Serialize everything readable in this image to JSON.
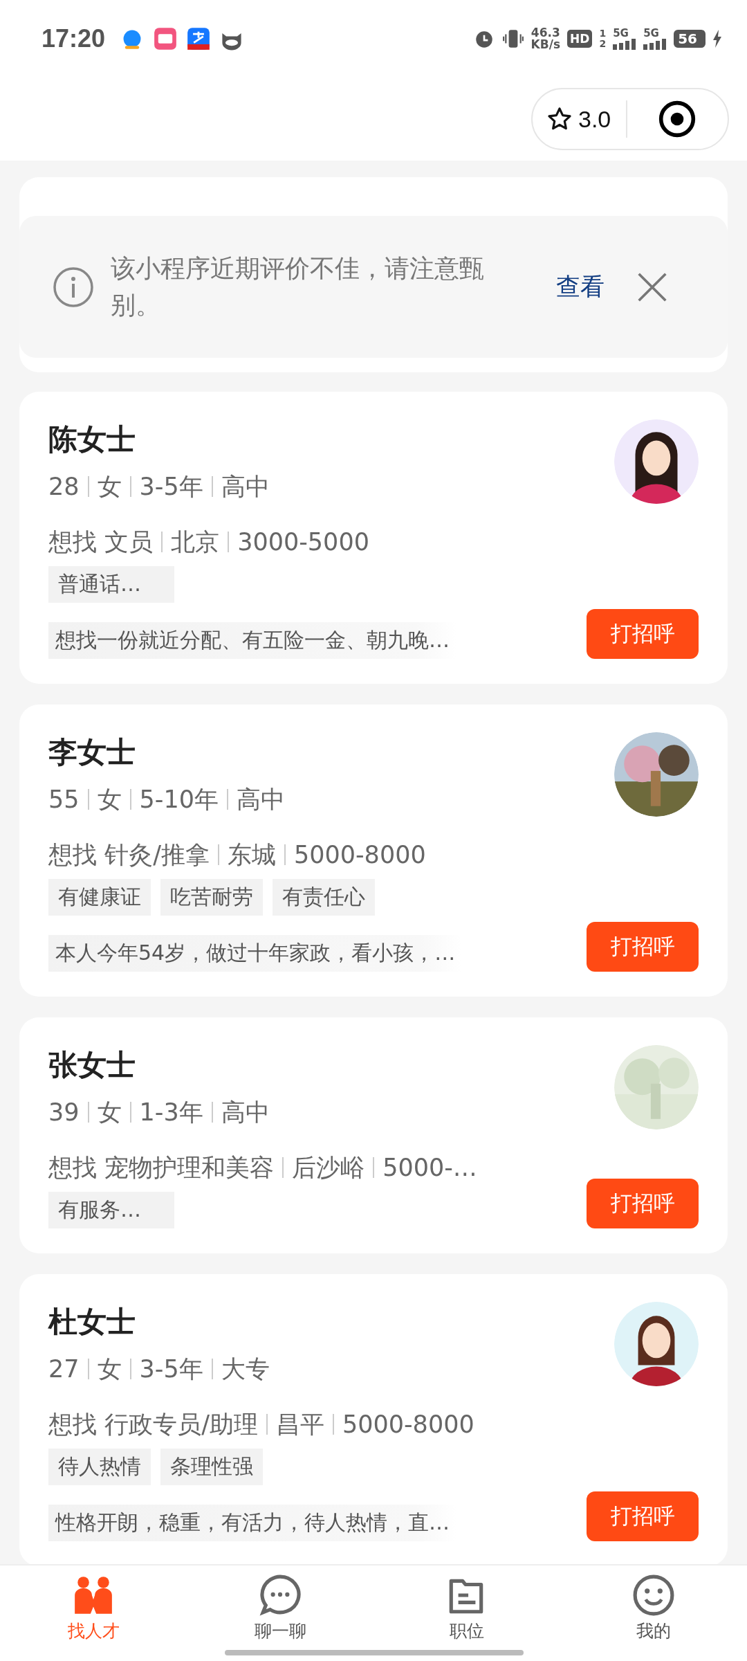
{
  "status_bar": {
    "time": "17:20",
    "net_speed": "46.3",
    "net_unit": "KB/s",
    "hd": "HD",
    "sim_1": "1",
    "sim_2": "2",
    "signal_1": "5G",
    "signal_2": "5G",
    "battery": "56"
  },
  "capsule": {
    "rating": "3.0"
  },
  "notice": {
    "text": "该小程序近期评价不佳，请注意甄别。",
    "action": "查看"
  },
  "candidates": [
    {
      "name": "陈女士",
      "meta": [
        "28",
        "女",
        "3-5年",
        "高中"
      ],
      "want": [
        "想找 文员",
        "北京",
        "3000-5000"
      ],
      "tags": [
        "普通话…"
      ],
      "intro": "想找一份就近分配、有五险一金、朝九晚…",
      "button": "打招呼",
      "avatar": {
        "kind": "illustration"
      }
    },
    {
      "name": "李女士",
      "meta": [
        "55",
        "女",
        "5-10年",
        "高中"
      ],
      "want": [
        "想找 针灸/推拿",
        "东城",
        "5000-8000"
      ],
      "tags": [
        "有健康证",
        "吃苦耐劳",
        "有责任心"
      ],
      "intro": "本人今年54岁，做过十年家政，看小孩，…",
      "button": "打招呼",
      "avatar": {
        "kind": "picture"
      }
    },
    {
      "name": "张女士",
      "meta": [
        "39",
        "女",
        "1-3年",
        "高中"
      ],
      "want": [
        "想找 宠物护理和美容",
        "后沙峪",
        "5000-…"
      ],
      "tags": [
        "有服务…"
      ],
      "button": "打招呼",
      "avatar": {
        "kind": "picture"
      }
    },
    {
      "name": "杜女士",
      "meta": [
        "27",
        "女",
        "3-5年",
        "大专"
      ],
      "want": [
        "想找 行政专员/助理",
        "昌平",
        "5000-8000"
      ],
      "tags": [
        "待人热情",
        "条理性强"
      ],
      "intro": "性格开朗，稳重，有活力，待人热情，直…",
      "button": "打招呼",
      "avatar": {
        "kind": "illustration"
      }
    }
  ],
  "tabs": [
    {
      "label": "找人才",
      "kind": "people",
      "selected": true
    },
    {
      "label": "聊一聊",
      "kind": "chat",
      "selected": false
    },
    {
      "label": "职位",
      "kind": "file",
      "selected": false
    },
    {
      "label": "我的",
      "kind": "smile",
      "selected": false
    }
  ]
}
